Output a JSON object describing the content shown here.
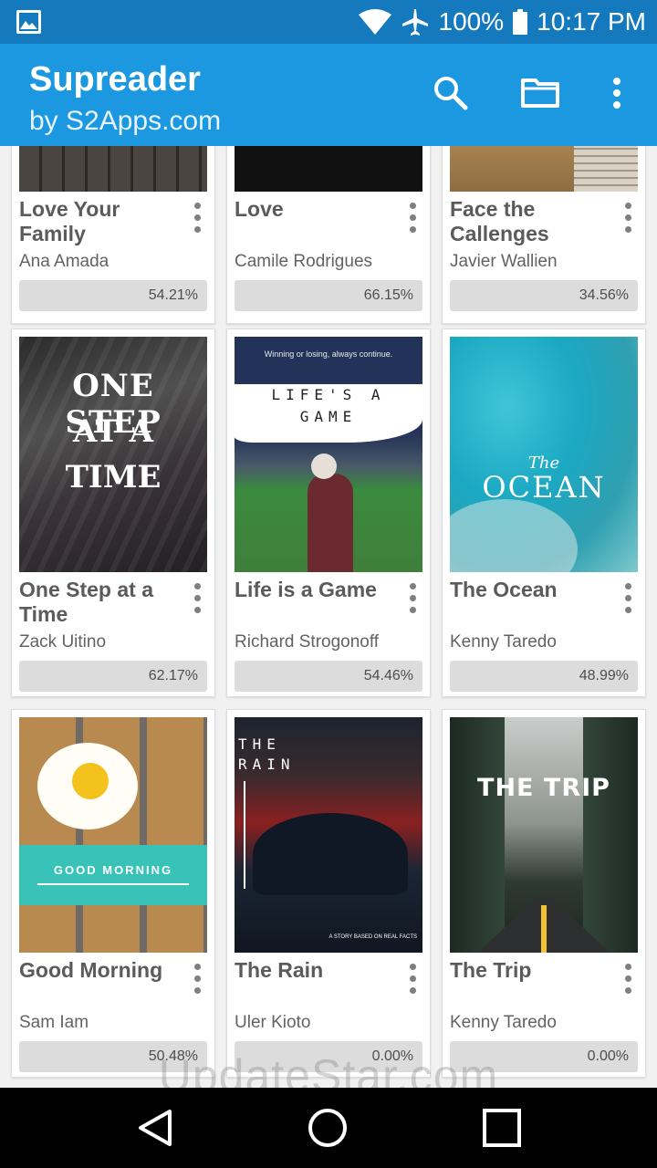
{
  "status": {
    "battery": "100%",
    "time": "10:17 PM"
  },
  "app": {
    "title": "Supreader",
    "subtitle": "by S2Apps.com"
  },
  "books": [
    {
      "title": "Love Your Family",
      "author": "Ana Amada",
      "progress": "54.21%"
    },
    {
      "title": "Love",
      "author": "Camile Rodrigues",
      "progress": "66.15%"
    },
    {
      "title": "Face the Callenges",
      "author": "Javier Wallien",
      "progress": "34.56%"
    },
    {
      "title": "One Step at a Time",
      "author": "Zack Uitino",
      "progress": "62.17%"
    },
    {
      "title": "Life is a Game",
      "author": "Richard Strogonoff",
      "progress": "54.46%"
    },
    {
      "title": "The Ocean",
      "author": "Kenny Taredo",
      "progress": "48.99%"
    },
    {
      "title": "Good Morning",
      "author": "Sam Iam",
      "progress": "50.48%"
    },
    {
      "title": "The Rain",
      "author": "Uler Kioto",
      "progress": "0.00%"
    },
    {
      "title": "The Trip",
      "author": "Kenny Taredo",
      "progress": "0.00%"
    }
  ],
  "covers": {
    "one_step": [
      "ONE STEP",
      "AT A",
      "TIME"
    ],
    "life_tagline": "Winning or losing, always continue.",
    "life_line1": "LIFE'S A",
    "life_line2": "GAME",
    "ocean_the": "The",
    "ocean_word": "OCEAN",
    "morning": "GOOD MORNING",
    "rain_the": "THE",
    "rain_word": "RAIN",
    "rain_foot": "A STORY BASED ON REAL FACTS",
    "trip": "THE TRIP"
  },
  "watermark": "UpdateStar.com"
}
